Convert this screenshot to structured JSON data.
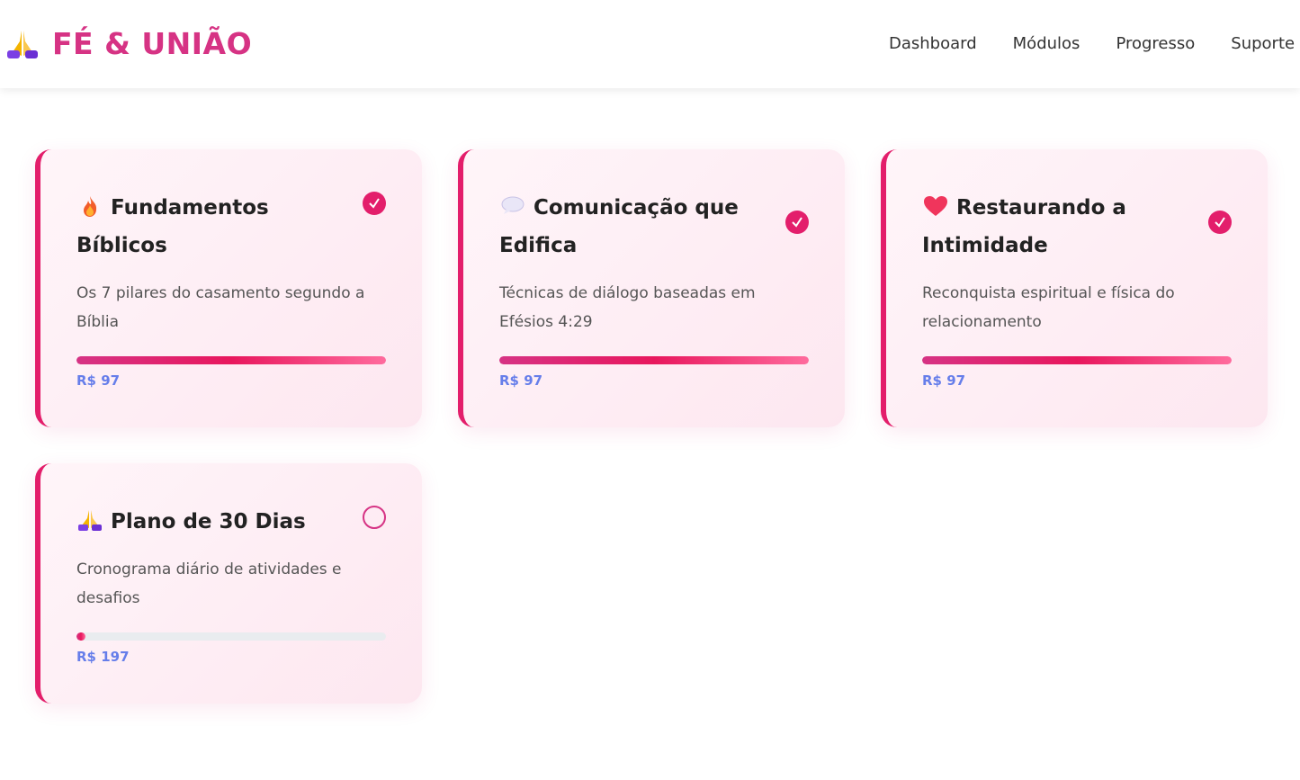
{
  "header": {
    "brand": "FÉ & UNIÃO",
    "nav": [
      "Dashboard",
      "Módulos",
      "Progresso",
      "Suporte"
    ]
  },
  "modules": [
    {
      "icon": "fire-icon",
      "title": "Fundamentos Bíblicos",
      "description": "Os 7 pilares do casamento segundo a Bíblia",
      "price": "R$ 97",
      "progress": 1.0,
      "completed": true
    },
    {
      "icon": "speech-bubble-icon",
      "title": "Comunicação que Edifica",
      "description": "Técnicas de diálogo baseadas em Efésios 4:29",
      "price": "R$ 97",
      "progress": 1.0,
      "completed": true
    },
    {
      "icon": "heart-icon",
      "title": "Restaurando a Intimidade",
      "description": "Reconquista espiritual e física do relacionamento",
      "price": "R$ 97",
      "progress": 1.0,
      "completed": true
    },
    {
      "icon": "praying-hands-icon",
      "title": "Plano de 30 Dias",
      "description": "Cronograma diário de atividades e desafios",
      "price": "R$ 197",
      "progress": 0.03,
      "completed": false
    }
  ],
  "colors": {
    "brand": "#d63384",
    "accent": "#e31e6b",
    "price": "#667eea"
  }
}
